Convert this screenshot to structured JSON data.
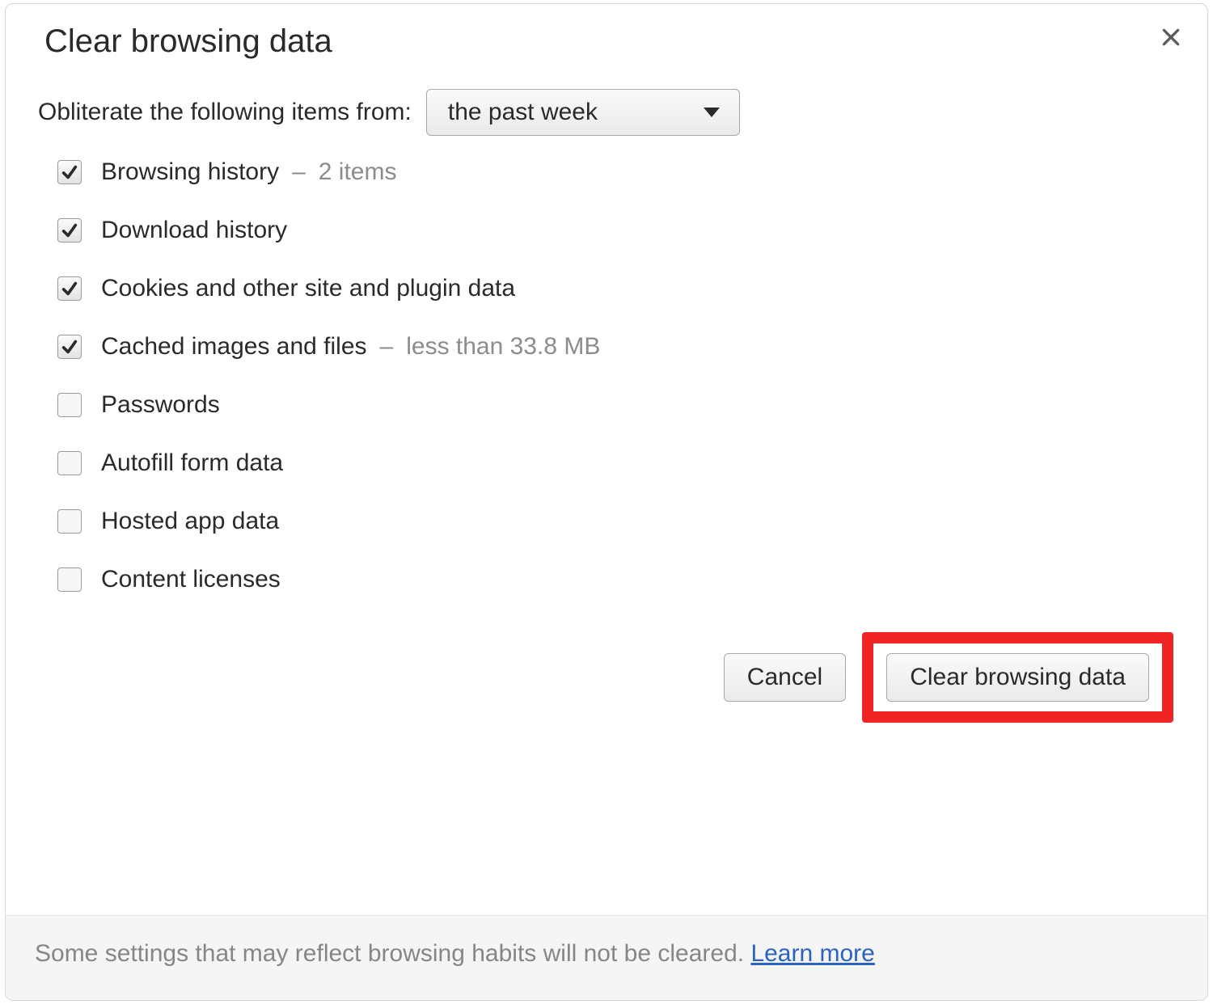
{
  "dialog": {
    "title": "Clear browsing data",
    "range_label": "Obliterate the following items from:",
    "range_selected": "the past week",
    "items": [
      {
        "key": "browsing-history",
        "label": "Browsing history",
        "checked": true,
        "sub": "2 items"
      },
      {
        "key": "download-history",
        "label": "Download history",
        "checked": true,
        "sub": ""
      },
      {
        "key": "cookies",
        "label": "Cookies and other site and plugin data",
        "checked": true,
        "sub": ""
      },
      {
        "key": "cache",
        "label": "Cached images and files",
        "checked": true,
        "sub": "less than 33.8 MB"
      },
      {
        "key": "passwords",
        "label": "Passwords",
        "checked": false,
        "sub": ""
      },
      {
        "key": "autofill",
        "label": "Autofill form data",
        "checked": false,
        "sub": ""
      },
      {
        "key": "hosted-app",
        "label": "Hosted app data",
        "checked": false,
        "sub": ""
      },
      {
        "key": "licenses",
        "label": "Content licenses",
        "checked": false,
        "sub": ""
      }
    ],
    "dash": "–",
    "cancel_label": "Cancel",
    "submit_label": "Clear browsing data",
    "footer_text": "Some settings that may reflect browsing habits will not be cleared. ",
    "footer_link": "Learn more"
  }
}
